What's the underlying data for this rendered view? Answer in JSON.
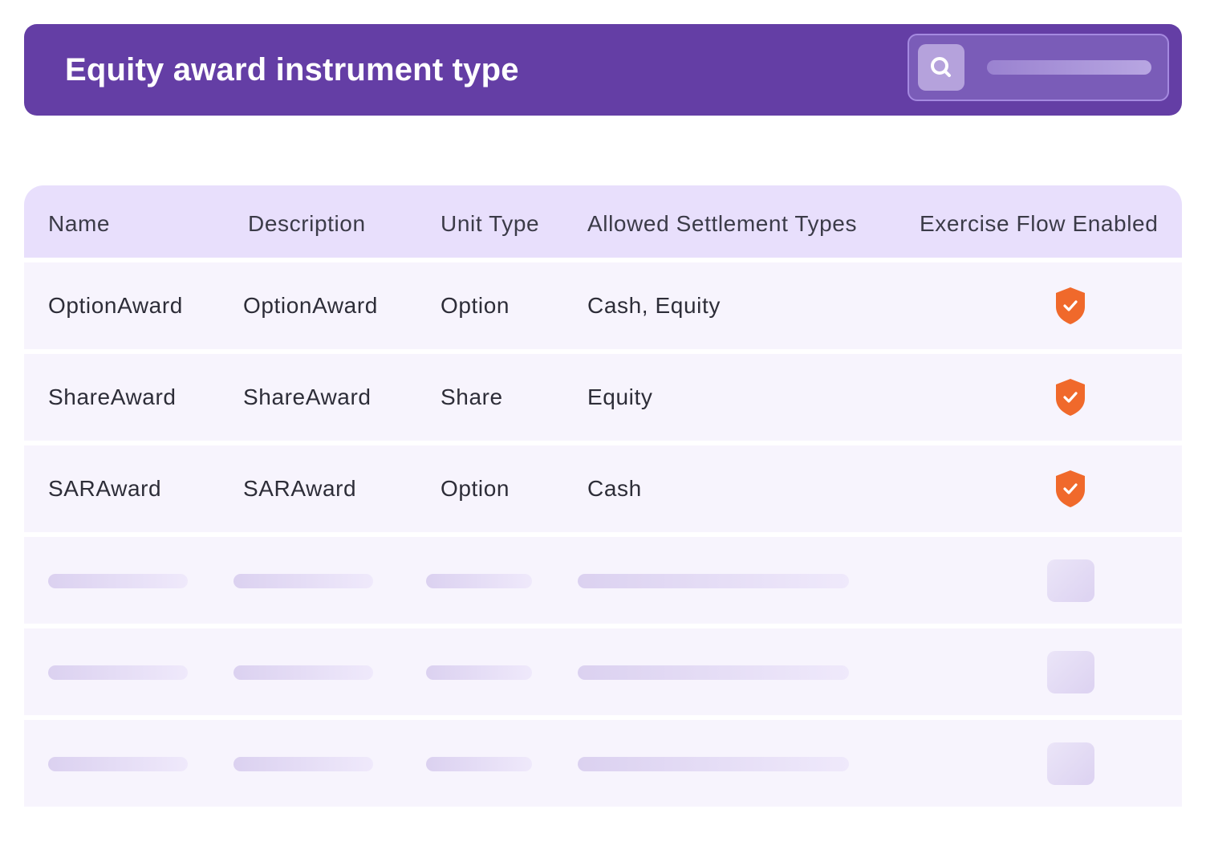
{
  "header": {
    "title": "Equity award instrument type",
    "search_icon": "search-icon",
    "colors": {
      "bar": "#643ea5",
      "search_border": "#a58ae0"
    }
  },
  "table": {
    "columns": [
      "Name",
      "Description",
      "Unit Type",
      "Allowed Settlement Types",
      "Exercise Flow Enabled"
    ],
    "rows": [
      {
        "name": "OptionAward",
        "description": "OptionAward",
        "unit_type": "Option",
        "settlement": "Cash, Equity",
        "exercise_flow_icon": "shield-check-icon"
      },
      {
        "name": "ShareAward",
        "description": "ShareAward",
        "unit_type": "Share",
        "settlement": "Equity",
        "exercise_flow_icon": "shield-check-icon"
      },
      {
        "name": "SARAward",
        "description": "SARAward",
        "unit_type": "Option",
        "settlement": "Cash",
        "exercise_flow_icon": "shield-check-icon"
      }
    ],
    "placeholder_rows": 3,
    "colors": {
      "header_bg": "#e8dffc",
      "row_bg": "#f7f4fd",
      "badge": "#f0692b"
    }
  }
}
